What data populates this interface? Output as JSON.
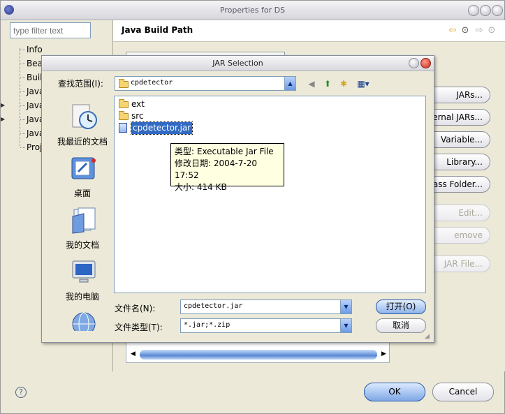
{
  "outer": {
    "title": "Properties for DS",
    "filter_placeholder": "type filter text",
    "tree": [
      "Info",
      "Bea",
      "Buil",
      "Java",
      "Java",
      "Java",
      "Java",
      "Proj"
    ],
    "header_title": "Java Build Path",
    "side_buttons": [
      "JARs...",
      "ernal JARs...",
      "Variable...",
      "Library...",
      "ass Folder...",
      "Edit...",
      "emove",
      "JAR File..."
    ],
    "ok_label": "OK",
    "cancel_label": "Cancel",
    "help_label": "?"
  },
  "dialog": {
    "title": "JAR Selection",
    "lookin_label": "查找范围(I):",
    "lookin_value": "cpdetector",
    "places": [
      "我最近的文档",
      "桌面",
      "我的文档",
      "我的电脑"
    ],
    "files": [
      {
        "name": "ext",
        "kind": "folder"
      },
      {
        "name": "src",
        "kind": "folder"
      },
      {
        "name": "cpdetector.jar",
        "kind": "jar"
      }
    ],
    "tooltip": {
      "type": "类型: Executable Jar File",
      "modified": "修改日期: 2004-7-20 17:52",
      "size": "大小: 414 KB"
    },
    "filename_label": "文件名(N):",
    "filename_value": "cpdetector.jar",
    "filetype_label": "文件类型(T):",
    "filetype_value": "*.jar;*.zip",
    "open_label": "打开(O)",
    "cancel_label": "取消"
  }
}
